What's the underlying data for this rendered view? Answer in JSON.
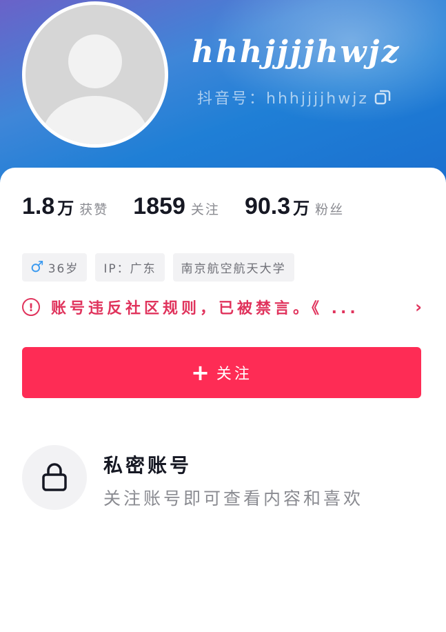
{
  "profile": {
    "username": "hhhjjjjhwjz",
    "account_id": "抖音号：hhhjjjjhwjz"
  },
  "stats": [
    {
      "value": "1.8",
      "unit": "万",
      "label": "获赞"
    },
    {
      "value": "1859",
      "unit": "",
      "label": "关注"
    },
    {
      "value": "90.3",
      "unit": "万",
      "label": "粉丝"
    }
  ],
  "tags": {
    "age": "36岁",
    "ip": "IP：广东",
    "school": "南京航空航天大学"
  },
  "notice": {
    "text": "账号违反社区规则，已被禁言。《 ..."
  },
  "follow_button": {
    "label": "关注"
  },
  "private_account": {
    "title": "私密账号",
    "description": "关注账号即可查看内容和喜欢"
  },
  "colors": {
    "accent": "#fe2c55",
    "warning": "#e0335c",
    "header_blue": "#1f7fd6",
    "gender_blue": "#3b9af0"
  }
}
